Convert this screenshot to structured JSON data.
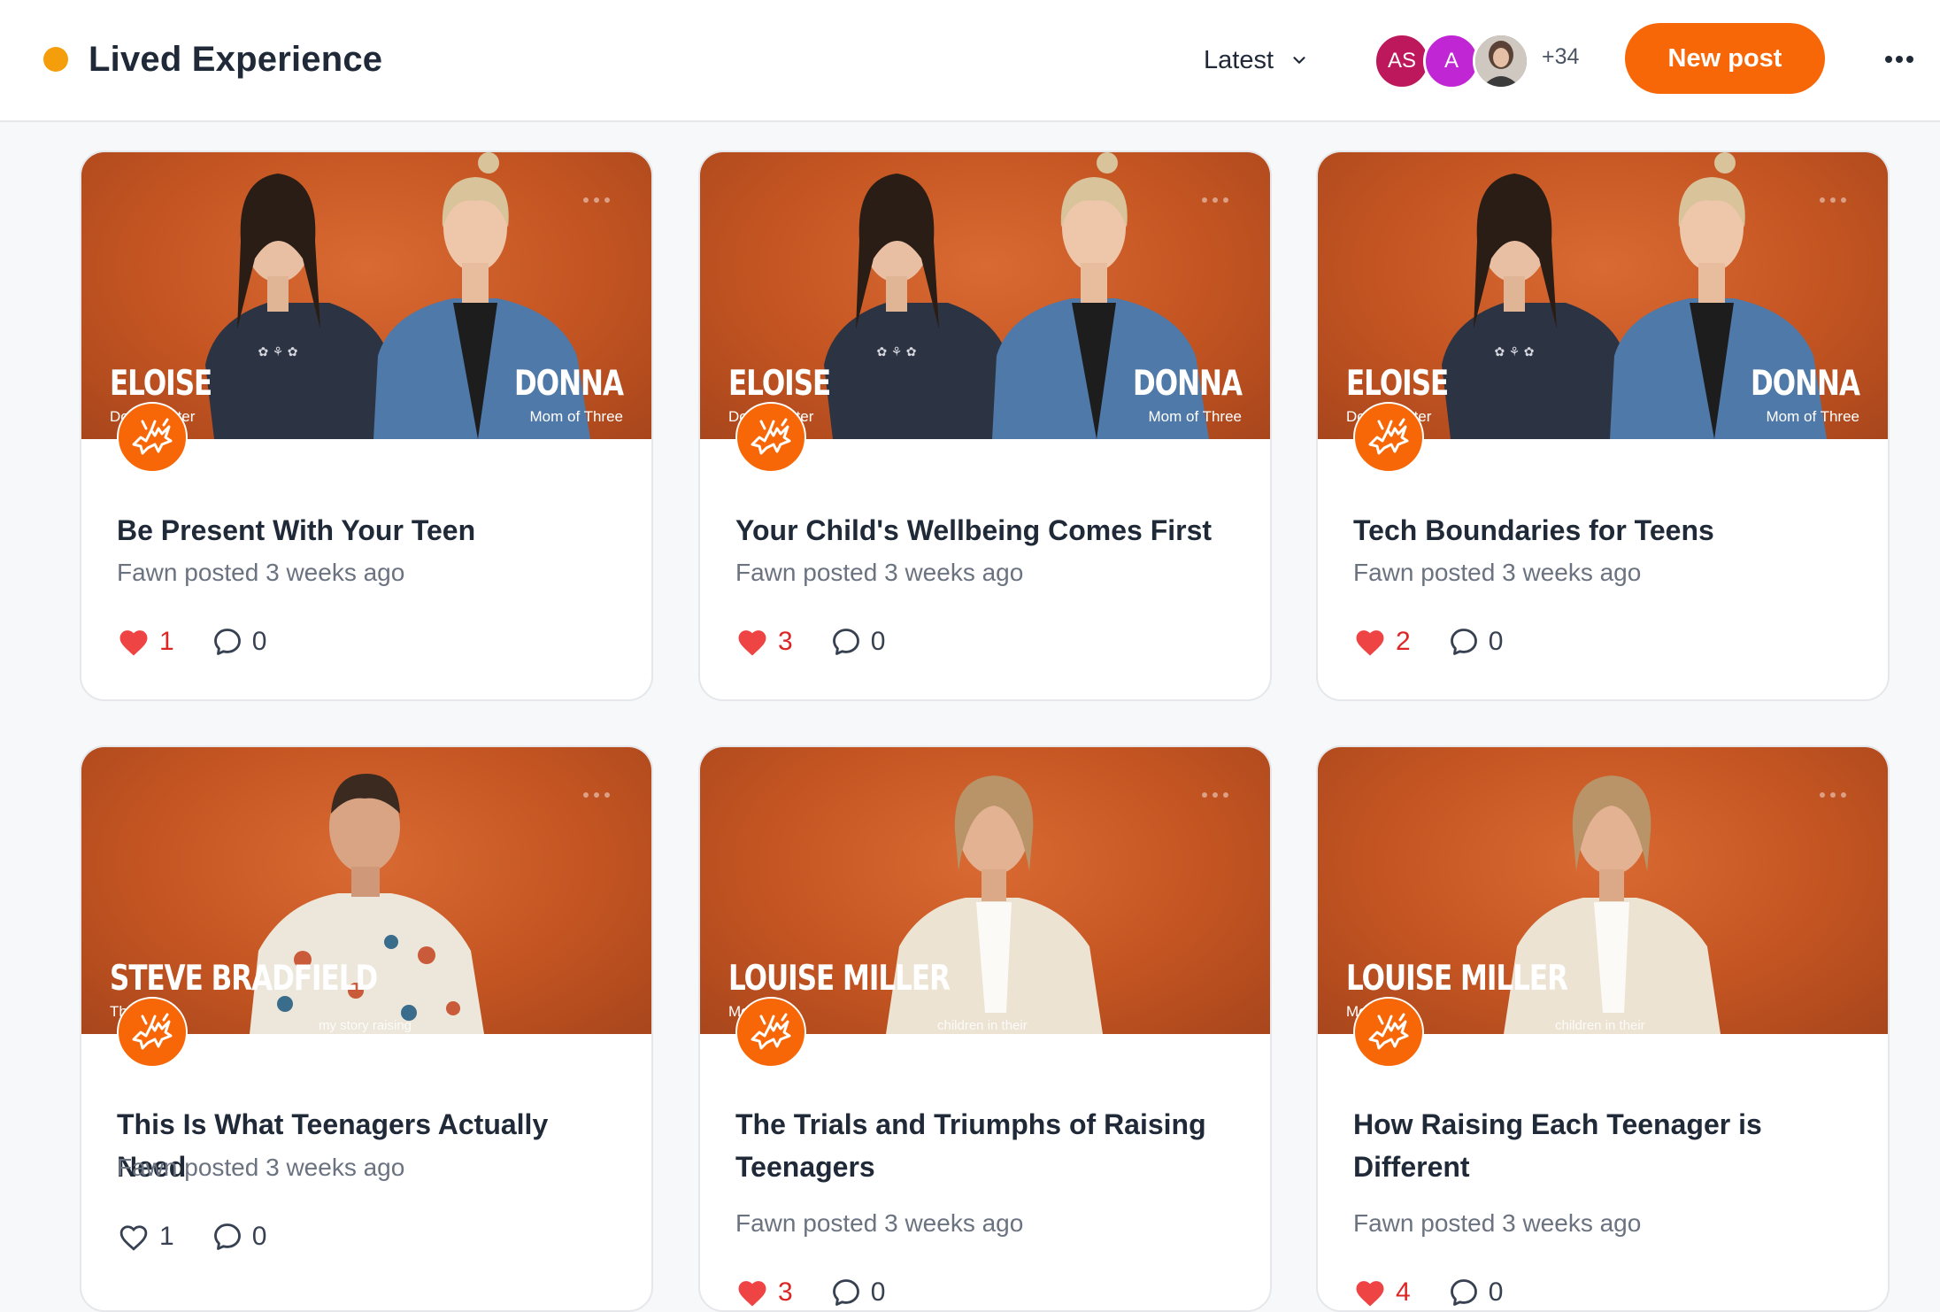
{
  "header": {
    "title": "Lived Experience",
    "sort_label": "Latest",
    "avatars": [
      {
        "initials": "AS",
        "color": "#be185d"
      },
      {
        "initials": "A",
        "color": "#c026d3"
      },
      {
        "initials": "",
        "kind": "photo"
      }
    ],
    "member_overflow": "+34",
    "new_post_label": "New post"
  },
  "colors": {
    "accent": "#f76707",
    "status_dot": "#f59e0b",
    "like": "#ef4444"
  },
  "posts": [
    {
      "title": "Be Present With Your Teen",
      "meta": "Fawn posted 3 weeks ago",
      "likes": "1",
      "liked": true,
      "comments": "0",
      "thumb": {
        "name_left": "ELOISE",
        "role_left": "Do   Daughter",
        "name_right": "DONNA",
        "role_right": "Mom of Three"
      }
    },
    {
      "title": "Your Child's Wellbeing Comes First",
      "meta": "Fawn posted 3 weeks ago",
      "likes": "3",
      "liked": true,
      "comments": "0",
      "thumb": {
        "name_left": "ELOISE",
        "role_left": "Do   Daughter",
        "name_right": "DONNA",
        "role_right": "Mom of Three"
      }
    },
    {
      "title": "Tech Boundaries for Teens",
      "meta": "Fawn posted 3 weeks ago",
      "likes": "2",
      "liked": true,
      "comments": "0",
      "thumb": {
        "name_left": "ELOISE",
        "role_left": "Do   Daughter",
        "name_right": "DONNA",
        "role_right": "Mom of Three"
      }
    },
    {
      "title": "This Is What Teenagers Actually Need",
      "meta": "Fawn posted 3 weeks ago",
      "likes": "1",
      "liked": false,
      "comments": "0",
      "thumb": {
        "name_left": "STEVE BRADFIELD",
        "role_left": "Th      n Dad",
        "caption": "my story raising"
      }
    },
    {
      "title": "The Trials and Triumphs of Raising Teenagers",
      "meta": "Fawn posted 3 weeks ago",
      "likes": "3",
      "liked": true,
      "comments": "0",
      "thumb": {
        "name_left": "LOUISE MILLER",
        "role_left": "Mo        three",
        "caption": "children in their"
      }
    },
    {
      "title": "How Raising Each Teenager is Different",
      "meta": "Fawn posted 3 weeks ago",
      "likes": "4",
      "liked": true,
      "comments": "0",
      "thumb": {
        "name_left": "LOUISE MILLER",
        "role_left": "Mo        three",
        "caption": "children in their"
      }
    }
  ]
}
